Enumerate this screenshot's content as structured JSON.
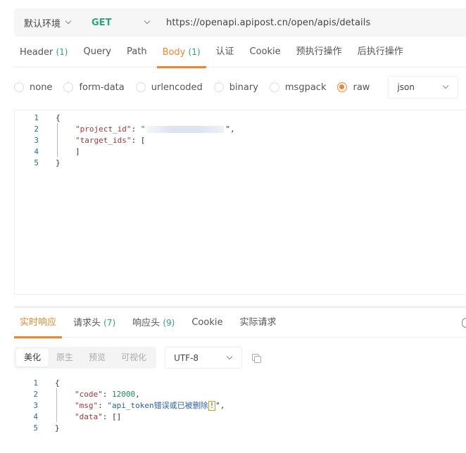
{
  "urlbar": {
    "environment": "默认环境",
    "method": "GET",
    "method_color": "#2aa57a",
    "url": "https://openapi.apipost.cn/open/apis/details"
  },
  "request_tabs": [
    {
      "label": "Header",
      "count": "(1)",
      "active": false
    },
    {
      "label": "Query",
      "count": "",
      "active": false
    },
    {
      "label": "Path",
      "count": "",
      "active": false
    },
    {
      "label": "Body",
      "count": "(1)",
      "active": true
    },
    {
      "label": "认证",
      "count": "",
      "active": false
    },
    {
      "label": "Cookie",
      "count": "",
      "active": false
    },
    {
      "label": "预执行操作",
      "count": "",
      "active": false
    },
    {
      "label": "后执行操作",
      "count": "",
      "active": false
    }
  ],
  "body_types": {
    "options": [
      "none",
      "form-data",
      "urlencoded",
      "binary",
      "msgpack",
      "raw"
    ],
    "selected": "raw",
    "raw_format": "json"
  },
  "request_body": {
    "line_numbers": [
      "1",
      "2",
      "3",
      "4",
      "5"
    ],
    "lines": {
      "l1": "{",
      "l2_key": "\"project_id\"",
      "l2_sep": ": ",
      "l2_open_quote": "\"",
      "l2_close": "\",",
      "l3_key": "\"target_ids\"",
      "l3_rest": ": [",
      "l4": "]",
      "l5": "}"
    }
  },
  "response_tabs": [
    {
      "label": "实时响应",
      "count": "",
      "active": true
    },
    {
      "label": "请求头",
      "count": "(7)",
      "active": false
    },
    {
      "label": "响应头",
      "count": "(9)",
      "active": false
    },
    {
      "label": "Cookie",
      "count": "",
      "active": false
    },
    {
      "label": "实际请求",
      "count": "",
      "active": false
    }
  ],
  "view_modes": {
    "options": [
      "美化",
      "原生",
      "预览",
      "可视化"
    ],
    "selected": "美化",
    "encoding": "UTF-8"
  },
  "response_body": {
    "line_numbers": [
      "1",
      "2",
      "3",
      "4",
      "5"
    ],
    "lines": {
      "l1": "{",
      "l2_key": "\"code\"",
      "l2_sep": ": ",
      "l2_val": "12000",
      "l2_end": ",",
      "l3_key": "\"msg\"",
      "l3_sep": ": ",
      "l3_val": "\"api_token错误或已被删除",
      "l3_cursor": "!",
      "l3_end": "\",",
      "l4_key": "\"data\"",
      "l4_rest": ": []",
      "l5": "}"
    }
  },
  "colors": {
    "accent": "#f1852d",
    "count_green": "#2aa57a",
    "json_key": "#b03434",
    "json_number": "#1e8a5e",
    "json_string": "#2a5fb0"
  }
}
